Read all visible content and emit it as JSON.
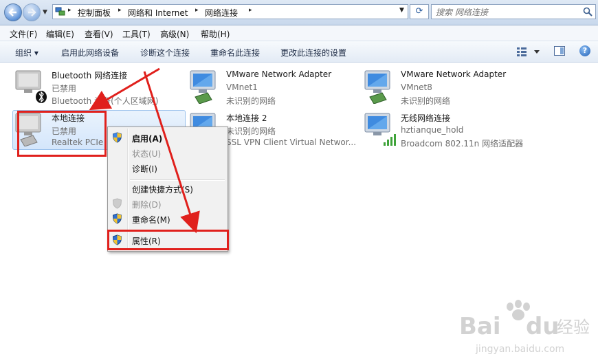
{
  "address_bar": {
    "breadcrumbs": [
      "控制面板",
      "网络和 Internet",
      "网络连接"
    ],
    "search_placeholder": "搜索 网络连接"
  },
  "menu": [
    "文件(F)",
    "编辑(E)",
    "查看(V)",
    "工具(T)",
    "高级(N)",
    "帮助(H)"
  ],
  "toolbar": {
    "organize": "组织 ▾",
    "enable": "启用此网络设备",
    "diagnose": "诊断这个连接",
    "rename": "重命名此连接",
    "change_settings": "更改此连接的设置"
  },
  "connections": [
    {
      "title": "Bluetooth 网络连接",
      "sub1": "已禁用",
      "sub2": "Bluetooth 设备(个人区域网)",
      "icon": "bluetooth-network-icon"
    },
    {
      "title": "VMware Network Adapter",
      "sub1": "VMnet1",
      "sub2": "未识别的网络",
      "icon": "network-adapter-icon"
    },
    {
      "title": "VMware Network Adapter",
      "sub1": "VMnet8",
      "sub2": "未识别的网络",
      "icon": "network-adapter-icon"
    },
    {
      "title": "本地连接",
      "sub1": "已禁用",
      "sub2": "Realtek PCIe",
      "icon": "ethernet-adapter-icon"
    },
    {
      "title": "本地连接 2",
      "sub1": "未识别的网络",
      "sub2": "SSL VPN Client Virtual Networ...",
      "icon": "network-adapter-icon"
    },
    {
      "title": "无线网络连接",
      "sub1": "hztianque_hold",
      "sub2": "Broadcom 802.11n 网络适配器",
      "icon": "wireless-adapter-icon"
    }
  ],
  "context_menu": {
    "enable": "启用(A)",
    "status": "状态(U)",
    "diagnose": "诊断(I)",
    "create_shortcut": "创建快捷方式(S)",
    "delete": "删除(D)",
    "rename": "重命名(M)",
    "properties": "属性(R)"
  },
  "watermark": {
    "brand_left": "Bai",
    "brand_right": "du",
    "brand_cn": "经验",
    "url": "jingyan.baidu.com"
  },
  "colors": {
    "annotation_red": "#e0201c",
    "selection_blue": "#d4e6fb"
  }
}
